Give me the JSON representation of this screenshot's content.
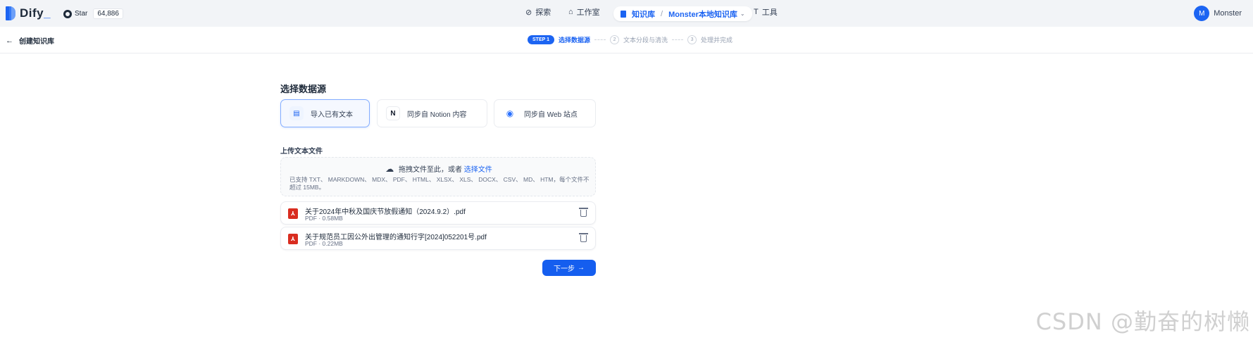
{
  "app": {
    "name": "Dify",
    "name_suffix": "_"
  },
  "github": {
    "label": "Star",
    "count": "64,886"
  },
  "nav": {
    "explore": "探索",
    "studio": "工作室",
    "knowledge": "知识库",
    "current_dataset": "Monster本地知识库",
    "tools": "工具"
  },
  "user": {
    "initial": "M",
    "name": "Monster"
  },
  "header": {
    "back_title": "创建知识库",
    "steps": [
      {
        "badge": "STEP 1",
        "label": "选择数据源"
      },
      {
        "num": "2",
        "label": "文本分段与清洗"
      },
      {
        "num": "3",
        "label": "处理并完成"
      }
    ]
  },
  "main": {
    "title": "选择数据源",
    "sources": {
      "file": "导入已有文本",
      "notion": "同步自 Notion 内容",
      "web": "同步自 Web 站点"
    },
    "upload_label": "上传文本文件",
    "dropzone": {
      "text": "拖拽文件至此，或者",
      "link": "选择文件",
      "hint": "已支持 TXT、 MARKDOWN、 MDX、 PDF、 HTML、 XLSX、 XLS、 DOCX、 CSV、 MD、 HTM，每个文件不超过 15MB。"
    },
    "files": [
      {
        "name": "关于2024年中秋及国庆节放假通知（2024.9.2）.pdf",
        "meta": "PDF · 0.58MB"
      },
      {
        "name": "关于规范员工因公外出管理的通知行字[2024]052201号.pdf",
        "meta": "PDF · 0.22MB"
      }
    ],
    "next_label": "下一步"
  },
  "watermark": "CSDN @勤奋的树懒"
}
